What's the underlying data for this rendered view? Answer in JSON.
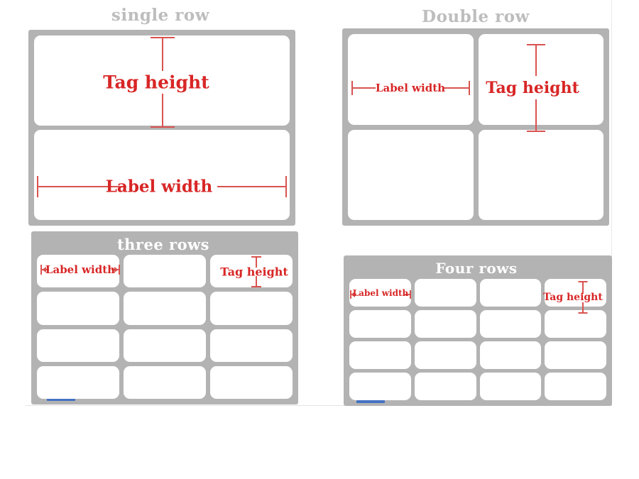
{
  "document": {
    "kind": "label-sheet-layout-diagram",
    "annotation_color": "#d9534f",
    "sheet_color": "#b3b3b3",
    "label_color": "#ffffff",
    "marker_color": "#4472c4",
    "title_outside_color": "#bdbdbd",
    "title_inside_color": "#ffffff"
  },
  "annotations": {
    "label_width": "Label width",
    "tag_height": "Tag height"
  },
  "panels": [
    {
      "id": "single-row",
      "title": "single row",
      "title_placement": "above",
      "columns": 1,
      "rows": 2,
      "label_count": 2,
      "annotations": [
        "Tag height",
        "Label width"
      ],
      "marker": false
    },
    {
      "id": "double-row",
      "title": "Double row",
      "title_placement": "above",
      "columns": 2,
      "rows": 2,
      "label_count": 4,
      "annotations": [
        "Label width",
        "Tag height"
      ],
      "marker": false
    },
    {
      "id": "three-rows",
      "title": "three rows",
      "title_placement": "inside",
      "columns": 3,
      "rows": 4,
      "label_count": 12,
      "annotations": [
        "Label width",
        "Tag height"
      ],
      "marker": true
    },
    {
      "id": "four-rows",
      "title": "Four rows",
      "title_placement": "inside",
      "columns": 4,
      "rows": 4,
      "label_count": 16,
      "annotations": [
        "Label width",
        "Tag height"
      ],
      "marker": true
    }
  ]
}
